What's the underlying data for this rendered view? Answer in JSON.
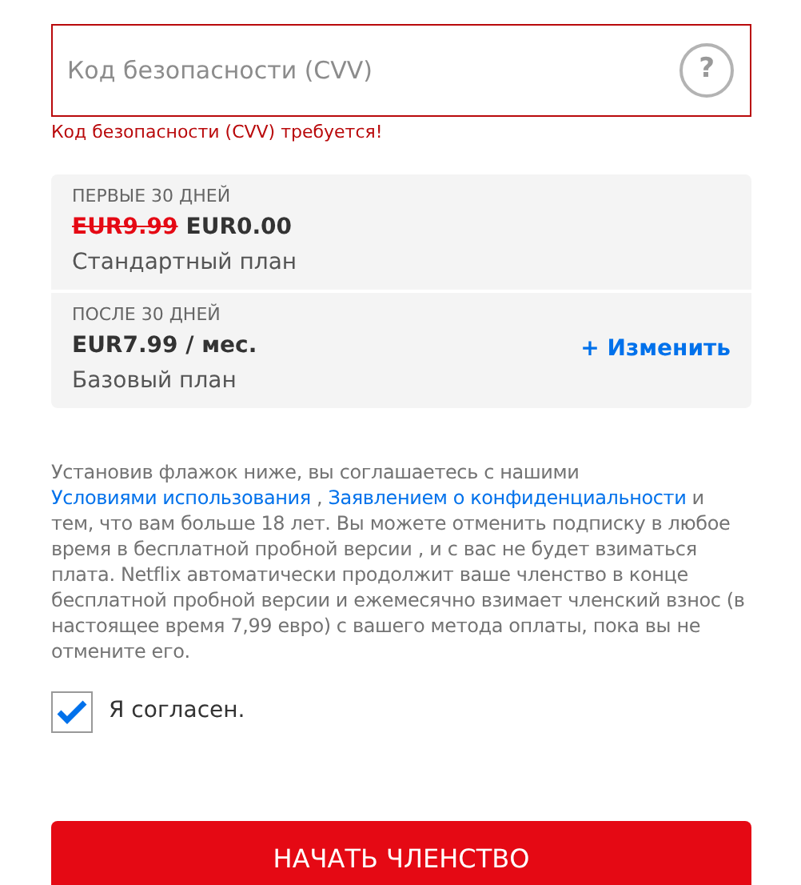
{
  "cvv_field": {
    "placeholder": "Код безопасности (CVV)",
    "help": "?",
    "invalid": true
  },
  "cvv_error": "Код безопасности (CVV) требуется!",
  "plan_periods": [
    {
      "heading": "ПЕРВЫЕ 30 ДНЕЙ",
      "old_price": "EUR9.99",
      "price": "EUR0.00",
      "plan": "Стандартный план"
    },
    {
      "heading": "ПОСЛЕ 30 ДНЕЙ",
      "price": "EUR7.99 / мес.",
      "plan": "Базовый план",
      "action": "+ Изменить"
    }
  ],
  "terms": [
    {
      "kind": "text",
      "text": "Установив флажок ниже, вы соглашаетесь с нашими "
    },
    {
      "kind": "link",
      "text": "Условиями использования"
    },
    {
      "kind": "text",
      "text": " , "
    },
    {
      "kind": "link",
      "text": "Заявлением о конфиденциальности"
    },
    {
      "kind": "text",
      "text": " и тем, что вам больше 18 лет. Вы можете отменить подписку в любое время в бесплатной пробной версии , и с вас не будет взиматься плата. Netflix автоматически продолжит ваше членство в конце бесплатной пробной версии и ежемесячно взимает членский взнос (в настоящее время 7,99 евро) с вашего метода оплаты, пока вы не отмените его."
    }
  ],
  "agree": {
    "label": "Я согласен.",
    "checked": true
  },
  "submit": "НАЧАТЬ ЧЛЕНСТВО"
}
